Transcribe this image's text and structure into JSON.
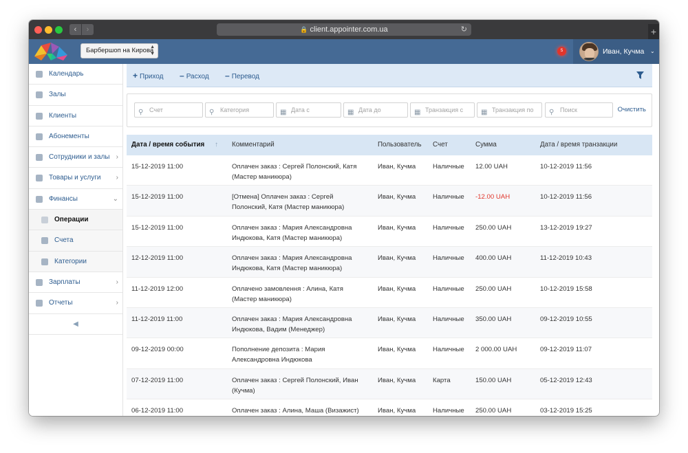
{
  "browser": {
    "url": "client.appointer.com.ua"
  },
  "header": {
    "branch": "Барбершоп на Кирова",
    "notification_count": "5",
    "user_name": "Иван, Кучма"
  },
  "sidebar": {
    "items": [
      {
        "label": "Календарь",
        "icon": "calendar-icon"
      },
      {
        "label": "Залы",
        "icon": "bookmark-icon"
      },
      {
        "label": "Клиенты",
        "icon": "users-icon"
      },
      {
        "label": "Абонементы",
        "icon": "card-icon"
      },
      {
        "label": "Сотрудники и залы",
        "icon": "id-card-icon"
      },
      {
        "label": "Товары и услуги",
        "icon": "card-icon"
      },
      {
        "label": "Финансы",
        "icon": "wallet-icon"
      },
      {
        "label": "Операции",
        "icon": "operations-icon"
      },
      {
        "label": "Счета",
        "icon": "list-icon"
      },
      {
        "label": "Категории",
        "icon": "tags-icon"
      },
      {
        "label": "Зарплаты",
        "icon": "bookmark-icon"
      },
      {
        "label": "Отчеты",
        "icon": "chart-icon"
      }
    ]
  },
  "toolbar": {
    "income": "Приход",
    "expense": "Расход",
    "transfer": "Перевод"
  },
  "filters": {
    "account": "Счет",
    "category": "Категория",
    "date_from": "Дата с",
    "date_to": "Дата до",
    "transaction_from": "Транзакция с",
    "transaction_to": "Транзакция по",
    "search": "Поиск",
    "clear": "Очистить"
  },
  "table": {
    "columns": [
      "Дата / время события",
      "Комментарий",
      "Пользователь",
      "Счет",
      "Сумма",
      "Дата / время транзакции"
    ],
    "rows": [
      {
        "date": "15-12-2019 11:00",
        "comment1": "Оплачен заказ : Сергей Полонский, Катя",
        "comment2": "(Мастер маникюра)",
        "user": "Иван, Кучма",
        "account": "Наличные",
        "amount": "12.00 UAH",
        "tx": "10-12-2019 11:56"
      },
      {
        "date": "15-12-2019 11:00",
        "comment1": "[Отмена] Оплачен заказ : Сергей",
        "comment2": "Полонский, Катя (Мастер маникюра)",
        "user": "Иван, Кучма",
        "account": "Наличные",
        "amount": "-12.00 UAH",
        "tx": "10-12-2019 11:56"
      },
      {
        "date": "15-12-2019 11:00",
        "comment1": "Оплачен заказ : Мария Александровна",
        "comment2": "Индюкова, Катя (Мастер маникюра)",
        "user": "Иван, Кучма",
        "account": "Наличные",
        "amount": "250.00 UAH",
        "tx": "13-12-2019 19:27"
      },
      {
        "date": "12-12-2019 11:00",
        "comment1": "Оплачен заказ : Мария Александровна",
        "comment2": "Индюкова, Катя (Мастер маникюра)",
        "user": "Иван, Кучма",
        "account": "Наличные",
        "amount": "400.00 UAH",
        "tx": "11-12-2019 10:43"
      },
      {
        "date": "11-12-2019 12:00",
        "comment1": "Оплачено замовлення : Алина, Катя",
        "comment2": "(Мастер маникюра)",
        "user": "Иван, Кучма",
        "account": "Наличные",
        "amount": "250.00 UAH",
        "tx": "10-12-2019 15:58"
      },
      {
        "date": "11-12-2019 11:00",
        "comment1": "Оплачен заказ : Мария Александровна",
        "comment2": "Индюкова, Вадим (Менеджер)",
        "user": "Иван, Кучма",
        "account": "Наличные",
        "amount": "350.00 UAH",
        "tx": "09-12-2019 10:55"
      },
      {
        "date": "09-12-2019 00:00",
        "comment1": "Пополнение депозита : Мария",
        "comment2": "Александровна Индюкова",
        "user": "Иван, Кучма",
        "account": "Наличные",
        "amount": "2 000.00 UAH",
        "tx": "09-12-2019 11:07"
      },
      {
        "date": "07-12-2019 11:00",
        "comment1": "Оплачен заказ : Сергей Полонский, Иван",
        "comment2": "(Кучма)",
        "user": "Иван, Кучма",
        "account": "Карта",
        "amount": "150.00 UAH",
        "tx": "05-12-2019 12:43"
      },
      {
        "date": "06-12-2019 11:00",
        "comment1": "Оплачен заказ : Алина, Маша (Визажист)",
        "comment2": "",
        "user": "Иван, Кучма",
        "account": "Наличные",
        "amount": "250.00 UAH",
        "tx": "03-12-2019 15:25"
      }
    ]
  },
  "colors": {
    "header": "#456a95",
    "accent": "#2d5c8f",
    "negative": "#e0352b",
    "toolbar": "#dde9f6"
  }
}
